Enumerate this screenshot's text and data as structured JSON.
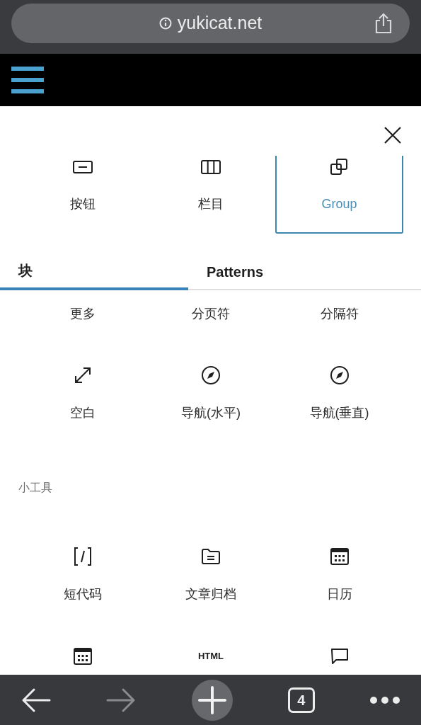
{
  "address_bar": {
    "url": "yukicat.net"
  },
  "recent_blocks": [
    {
      "label": "按钮",
      "selected": false
    },
    {
      "label": "栏目",
      "selected": false
    },
    {
      "label": "Group",
      "selected": true
    }
  ],
  "tabs": [
    {
      "label": "块",
      "selected": true
    },
    {
      "label": "Patterns",
      "selected": false
    }
  ],
  "block_rows": [
    {
      "items": [
        {
          "label": "更多"
        },
        {
          "label": "分页符"
        },
        {
          "label": "分隔符"
        }
      ]
    },
    {
      "items": [
        {
          "label": "空白"
        },
        {
          "label": "导航(水平)"
        },
        {
          "label": "导航(垂直)"
        }
      ]
    }
  ],
  "widgets": {
    "heading": "小工具",
    "rows": [
      {
        "items": [
          {
            "label": "短代码"
          },
          {
            "label": "文章归档"
          },
          {
            "label": "日历"
          }
        ]
      },
      {
        "items": [
          {
            "kind": "icon"
          },
          {
            "kind": "glyph",
            "glyph": "HTML"
          },
          {
            "kind": "icon"
          }
        ]
      }
    ]
  },
  "toolbar": {
    "tab_count": "4",
    "forward_disabled": true
  }
}
